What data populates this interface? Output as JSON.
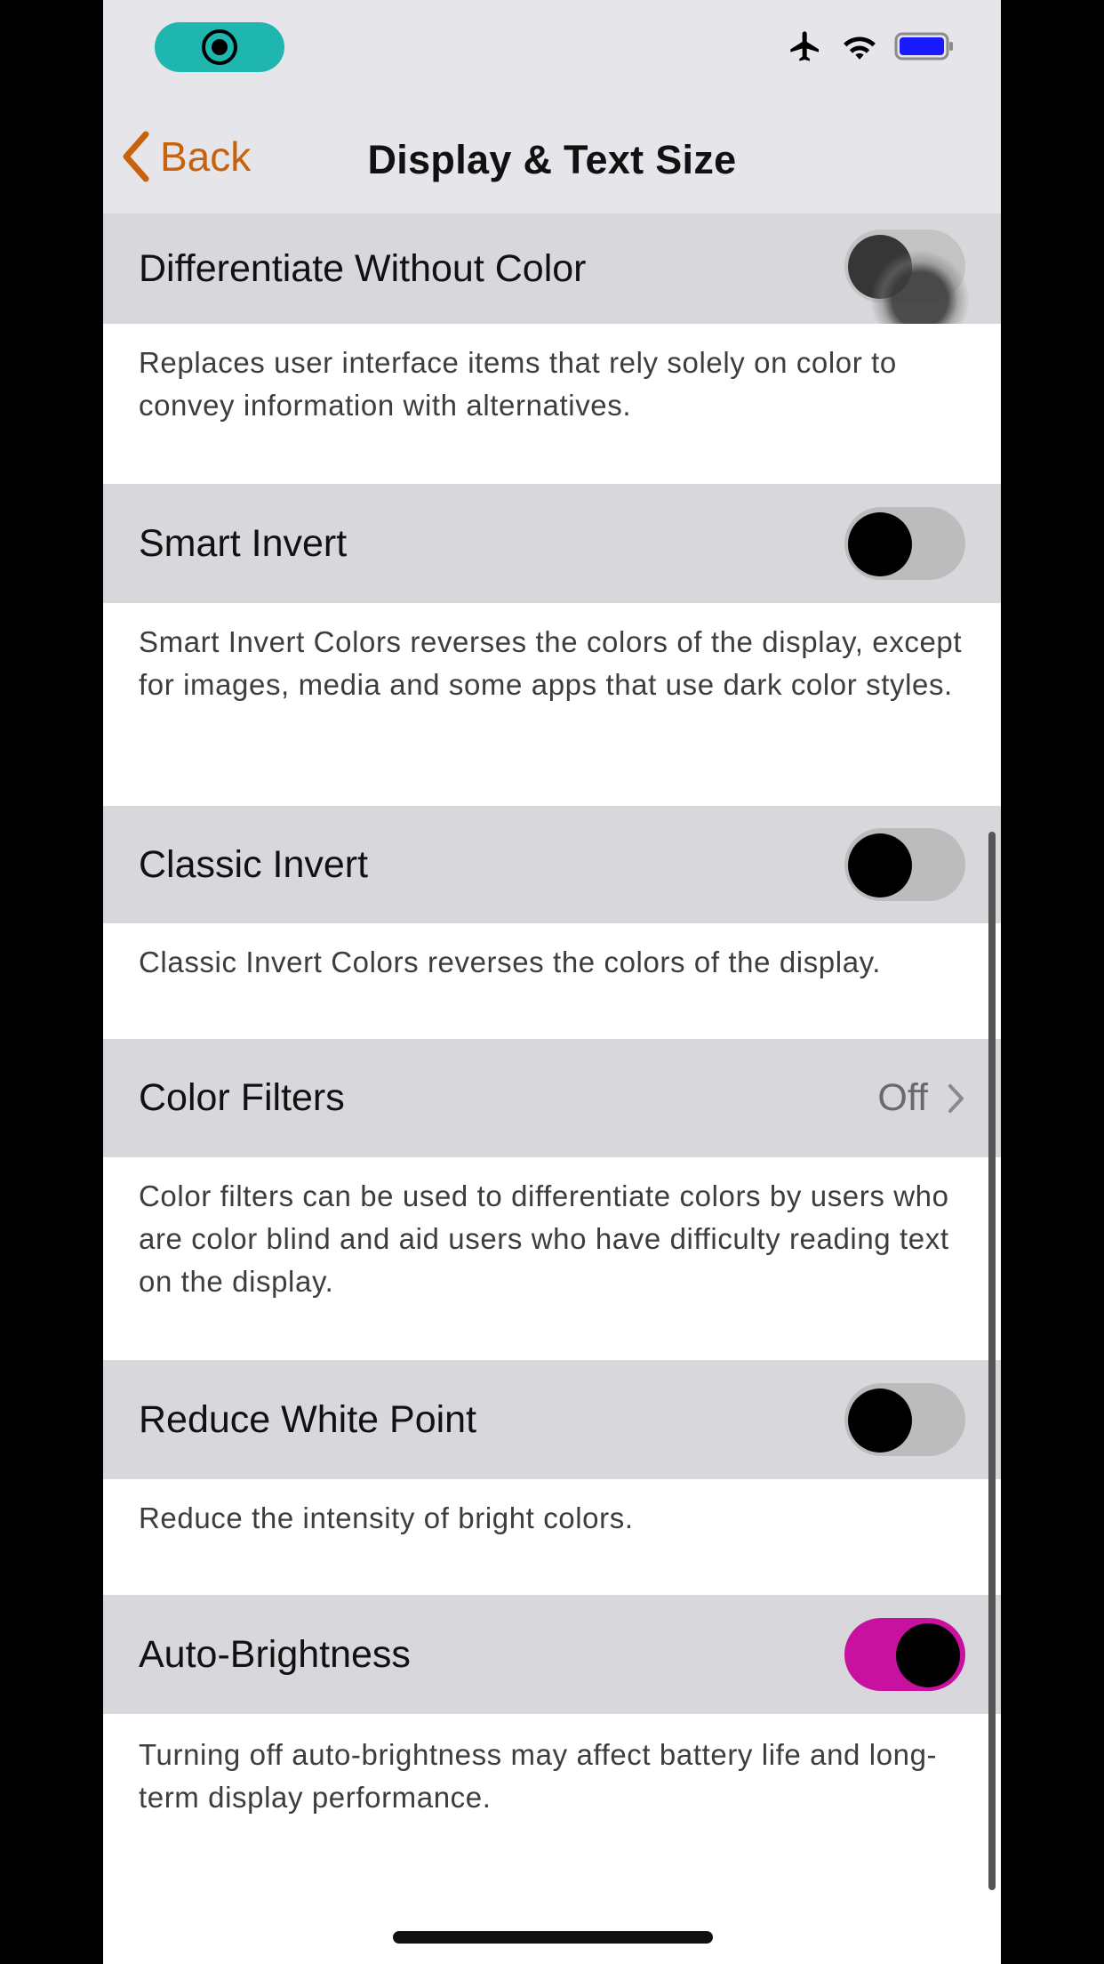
{
  "nav": {
    "back_label": "Back",
    "title": "Display & Text Size"
  },
  "settings": {
    "differentiate": {
      "label": "Differentiate Without Color",
      "description": "Replaces user interface items that rely solely on color to convey information with alternatives.",
      "on": false
    },
    "smart_invert": {
      "label": "Smart Invert",
      "description": "Smart Invert Colors reverses the colors of the display, except for images, media and some apps that use dark color styles.",
      "on": false
    },
    "classic_invert": {
      "label": "Classic Invert",
      "description": "Classic Invert Colors reverses the colors of the display.",
      "on": false
    },
    "color_filters": {
      "label": "Color Filters",
      "value": "Off",
      "description": "Color filters can be used to differentiate colors by users who are color blind and aid users who have difficulty reading text on the display."
    },
    "reduce_white_point": {
      "label": "Reduce White Point",
      "description": "Reduce the intensity of bright colors.",
      "on": false
    },
    "auto_brightness": {
      "label": "Auto-Brightness",
      "description": "Turning off auto-brightness may affect battery life and long-term display performance.",
      "on": true
    }
  },
  "colors": {
    "accent": "#c8620c",
    "toggle_on": "#c8119e",
    "toggle_off": "#bcbcbc",
    "row_bg": "#d8d8dc",
    "bar_bg": "#e5e5ea"
  },
  "icons": {
    "status": [
      "screen-recording-icon",
      "airplane-icon",
      "wifi-icon",
      "battery-icon"
    ],
    "nav": [
      "chevron-left-icon"
    ],
    "row": [
      "chevron-right-icon"
    ]
  }
}
